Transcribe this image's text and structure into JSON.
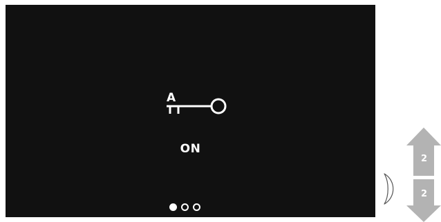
{
  "display": {
    "key_icon_letter": "A",
    "status": "ON",
    "pager": {
      "current_page": 1,
      "total_pages": 3
    }
  },
  "controls": {
    "up_button_label": "2",
    "down_button_label": "2"
  },
  "colors": {
    "screen_background": "#111111",
    "foreground": "#ffffff",
    "button_fill": "#b3b3b3"
  }
}
